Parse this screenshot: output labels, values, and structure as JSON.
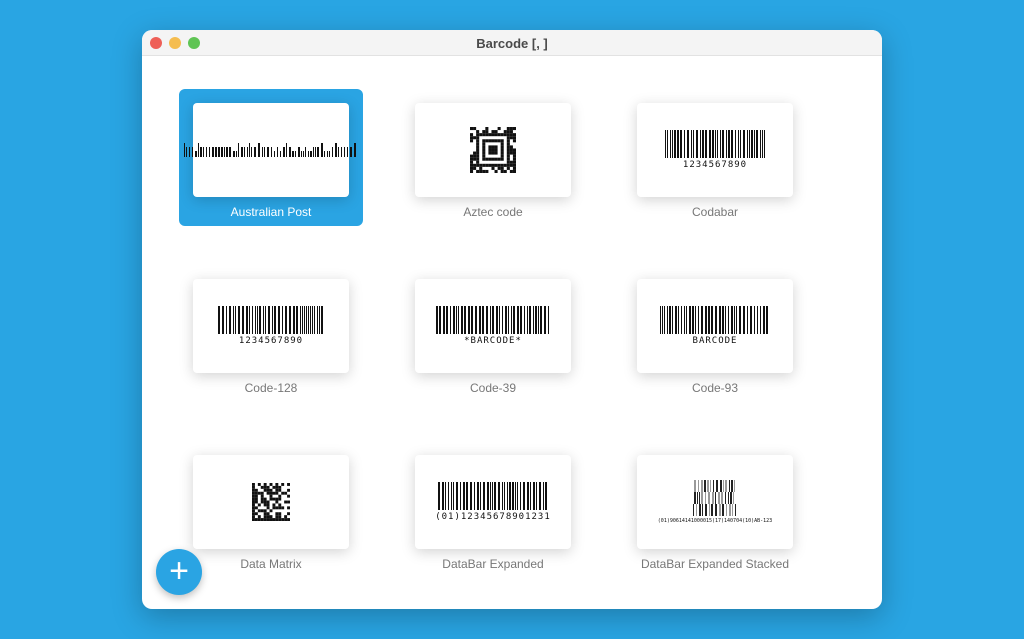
{
  "window": {
    "title": "Barcode [, ]"
  },
  "items": [
    {
      "label": "Australian Post",
      "kind": "aupost",
      "selected": true
    },
    {
      "label": "Aztec code",
      "kind": "aztec"
    },
    {
      "label": "Codabar",
      "kind": "linear",
      "text": "1234567890"
    },
    {
      "label": "Code-128",
      "kind": "linear",
      "text": "1234567890"
    },
    {
      "label": "Code-39",
      "kind": "linear",
      "text": "*BARCODE*"
    },
    {
      "label": "Code-93",
      "kind": "linear",
      "text": "BARCODE"
    },
    {
      "label": "Data Matrix",
      "kind": "matrix"
    },
    {
      "label": "DataBar Expanded",
      "kind": "linear",
      "text": "(01)12345678901231"
    },
    {
      "label": "DataBar Expanded Stacked",
      "kind": "stacked",
      "text": "(01)90614141000015(17)140704(10)AB-123"
    }
  ],
  "fab": {
    "label": "+",
    "icon": "plus-icon"
  },
  "colors": {
    "background": "#29a5e3",
    "accent": "#2aa4e3"
  }
}
